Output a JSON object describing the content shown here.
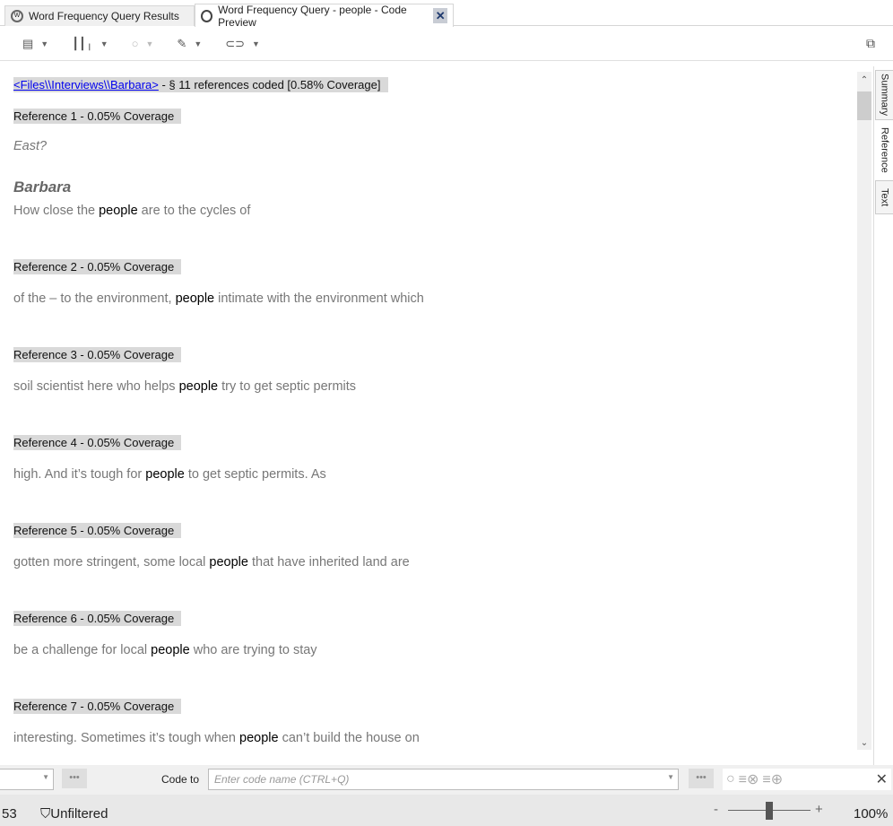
{
  "tabs": [
    {
      "label": "Word Frequency Query Results",
      "icon": "query-icon"
    },
    {
      "label": "Word Frequency Query - people - Code Preview",
      "icon": "circle-icon",
      "close": "✕"
    }
  ],
  "toolbar": {
    "items": [
      "annotation-icon",
      "chart-icon",
      "circle-icon",
      "highlight-icon",
      "link-icon"
    ]
  },
  "header": {
    "link": "<Files\\\\Interviews\\\\Barbara>",
    "summary": " - § 11 references coded  [0.58% Coverage]"
  },
  "first": {
    "ref": "Reference 1 - 0.05% Coverage",
    "question": "East?",
    "speaker": "Barbara",
    "before": "How close the ",
    "keyword": "people",
    "after": " are to the cycles of"
  },
  "references": [
    {
      "ref": "Reference 2 - 0.05% Coverage",
      "before": "of the – to the environment, ",
      "keyword": "people",
      "after": " intimate with the environment which"
    },
    {
      "ref": "Reference 3 - 0.05% Coverage",
      "before": "soil scientist here who helps ",
      "keyword": "people",
      "after": " try to get septic permits"
    },
    {
      "ref": "Reference 4 - 0.05% Coverage",
      "before": "high. And it’s tough for ",
      "keyword": "people",
      "after": " to get septic permits. As"
    },
    {
      "ref": "Reference 5 - 0.05% Coverage",
      "before": "gotten more stringent, some local ",
      "keyword": "people",
      "after": " that have inherited land are"
    },
    {
      "ref": "Reference 6 - 0.05% Coverage",
      "before": "be a challenge for local ",
      "keyword": "people",
      "after": " who are trying to stay"
    },
    {
      "ref": "Reference 7 - 0.05% Coverage",
      "before": "interesting. Sometimes it’s tough when ",
      "keyword": "people",
      "after": " can’t build the house on"
    }
  ],
  "sidetabs": [
    "Summary",
    "Reference",
    "Text"
  ],
  "bottom": {
    "code_to": "Code to",
    "placeholder": "Enter code name (CTRL+Q)",
    "dots": "•••"
  },
  "status": {
    "count": "53",
    "filter": "Unfiltered",
    "zoom": "100%",
    "zoom_fraction": 0.5
  }
}
